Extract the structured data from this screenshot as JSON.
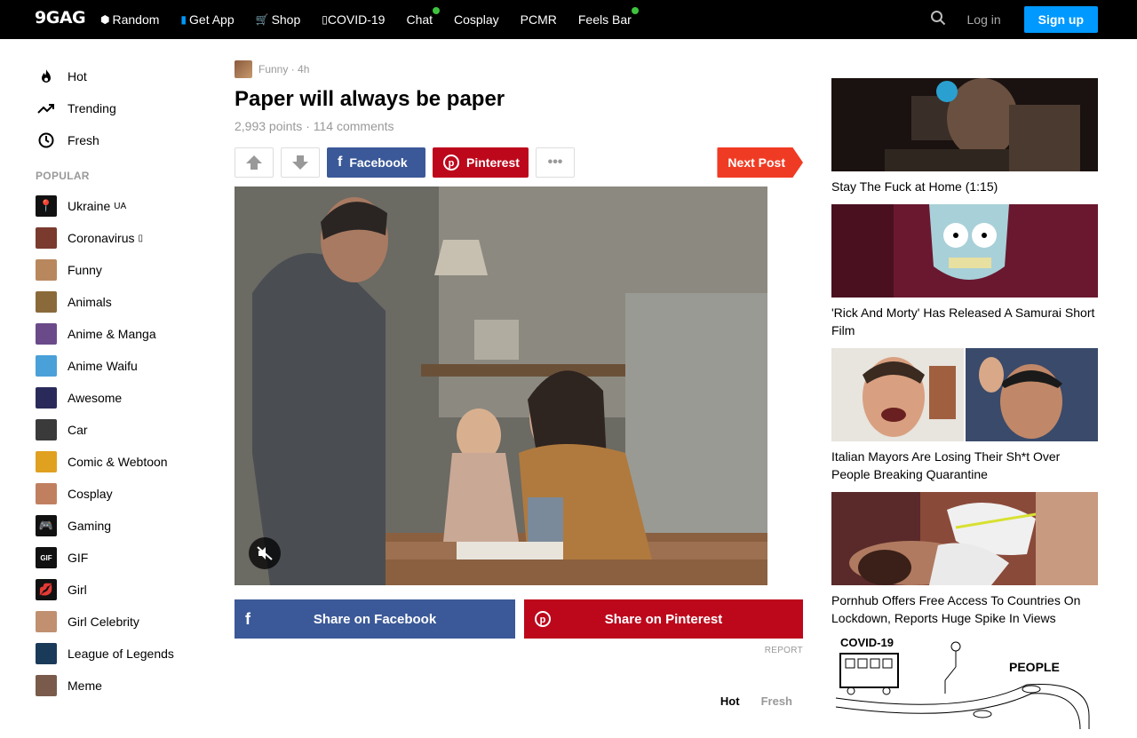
{
  "header": {
    "logo": "9GAG",
    "nav": [
      {
        "label": "Random",
        "icon": "dice-icon",
        "glyph": "⬢",
        "dot": false
      },
      {
        "label": "Get App",
        "icon": "phone-icon",
        "glyph": "▮",
        "dot": false
      },
      {
        "label": "Shop",
        "icon": "cart-icon",
        "glyph": "🛒",
        "dot": false
      },
      {
        "label": "COVID-19",
        "icon": "covid-icon",
        "glyph": "▯",
        "dot": false
      },
      {
        "label": "Chat",
        "icon": "",
        "glyph": "",
        "dot": true
      },
      {
        "label": "Cosplay",
        "icon": "",
        "glyph": "",
        "dot": false
      },
      {
        "label": "PCMR",
        "icon": "",
        "glyph": "",
        "dot": false
      },
      {
        "label": "Feels Bar",
        "icon": "",
        "glyph": "",
        "dot": true
      }
    ],
    "login": "Log in",
    "signup": "Sign up",
    "colors": {
      "bar": "#000000",
      "signup": "#0099ff",
      "dot": "#3ec33e"
    }
  },
  "sidebar": {
    "main": [
      {
        "label": "Hot",
        "icon": "flame-icon",
        "glyph": "🔥"
      },
      {
        "label": "Trending",
        "icon": "trending-icon",
        "glyph": "↗"
      },
      {
        "label": "Fresh",
        "icon": "clock-icon",
        "glyph": "◷"
      }
    ],
    "popular_heading": "POPULAR",
    "sections": [
      {
        "label": "Ukraine",
        "suffix": "UA",
        "color": "#111111",
        "glyph": "📍"
      },
      {
        "label": "Coronavirus",
        "suffix": "▯",
        "color": "#7a3a2e",
        "glyph": ""
      },
      {
        "label": "Funny",
        "suffix": "",
        "color": "#b9875e",
        "glyph": ""
      },
      {
        "label": "Animals",
        "suffix": "",
        "color": "#8a6a3a",
        "glyph": ""
      },
      {
        "label": "Anime & Manga",
        "suffix": "",
        "color": "#6b4a8a",
        "glyph": ""
      },
      {
        "label": "Anime Waifu",
        "suffix": "",
        "color": "#4aa0d8",
        "glyph": ""
      },
      {
        "label": "Awesome",
        "suffix": "",
        "color": "#2a2a5a",
        "glyph": ""
      },
      {
        "label": "Car",
        "suffix": "",
        "color": "#3a3a3a",
        "glyph": ""
      },
      {
        "label": "Comic & Webtoon",
        "suffix": "",
        "color": "#e0a020",
        "glyph": ""
      },
      {
        "label": "Cosplay",
        "suffix": "",
        "color": "#c08060",
        "glyph": ""
      },
      {
        "label": "Gaming",
        "suffix": "",
        "color": "#111111",
        "glyph": "🎮"
      },
      {
        "label": "GIF",
        "suffix": "",
        "color": "#111111",
        "glyph": "GIF"
      },
      {
        "label": "Girl",
        "suffix": "",
        "color": "#111111",
        "glyph": "💋"
      },
      {
        "label": "Girl Celebrity",
        "suffix": "",
        "color": "#c09070",
        "glyph": ""
      },
      {
        "label": "League of Legends",
        "suffix": "",
        "color": "#1a3a5a",
        "glyph": ""
      },
      {
        "label": "Meme",
        "suffix": "",
        "color": "#7a5a4a",
        "glyph": ""
      }
    ]
  },
  "post": {
    "section": "Funny",
    "age": "4h",
    "title": "Paper will always be paper",
    "points": "2,993 points",
    "comments": "114 comments",
    "facebook": "Facebook",
    "pinterest": "Pinterest",
    "more": "•••",
    "next_post": "Next Post",
    "share_facebook": "Share on Facebook",
    "share_pinterest": "Share on Pinterest",
    "report": "REPORT",
    "comment_tabs": [
      "Hot",
      "Fresh"
    ],
    "colors": {
      "facebook": "#3b5998",
      "pinterest": "#bd081c",
      "next": "#f03b24"
    }
  },
  "recommended": [
    {
      "title": "Stay The Fuck at Home (1:15)"
    },
    {
      "title": "'Rick And Morty' Has Released A Samurai Short Film"
    },
    {
      "title": "Italian Mayors Are Losing Their Sh*t Over People Breaking Quarantine"
    },
    {
      "title": "Pornhub Offers Free Access To Countries On Lockdown, Reports Huge Spike In Views"
    },
    {
      "title": "",
      "image_labels": [
        "COVID-19",
        "PEOPLE"
      ]
    }
  ]
}
